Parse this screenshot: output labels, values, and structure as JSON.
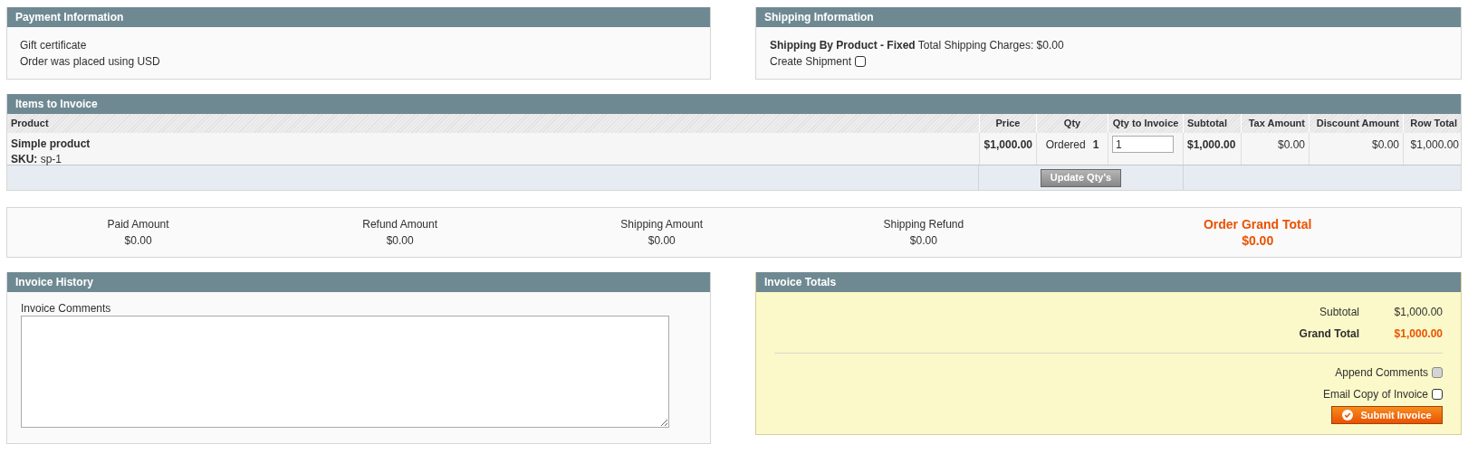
{
  "payment": {
    "title": "Payment Information",
    "lines": [
      "Gift certificate",
      "Order was placed using USD"
    ]
  },
  "shipping": {
    "title": "Shipping Information",
    "method": "Shipping By Product - Fixed",
    "charges": "Total Shipping Charges: $0.00",
    "create_shipment": {
      "label": "Create Shipment",
      "checked": false
    }
  },
  "items": {
    "title": "Items to Invoice",
    "columns": [
      "Product",
      "Price",
      "Qty",
      "Qty to Invoice",
      "Subtotal",
      "Tax Amount",
      "Discount Amount",
      "Row Total"
    ],
    "rows": [
      {
        "name": "Simple product",
        "sku_label": "SKU:",
        "sku": "sp-1",
        "price": "$1,000.00",
        "qty_label": "Ordered",
        "qty": "1",
        "qty_to_invoice": "1",
        "subtotal": "$1,000.00",
        "tax": "$0.00",
        "discount": "$0.00",
        "row_total": "$1,000.00"
      }
    ],
    "update_button": "Update Qty's"
  },
  "summary": [
    {
      "label": "Paid Amount",
      "value": "$0.00",
      "kind": "plain"
    },
    {
      "label": "Refund Amount",
      "value": "$0.00",
      "kind": "plain"
    },
    {
      "label": "Shipping Amount",
      "value": "$0.00",
      "kind": "plain"
    },
    {
      "label": "Shipping Refund",
      "value": "$0.00",
      "kind": "plain"
    },
    {
      "label": "Order Grand Total",
      "value": "$0.00",
      "kind": "grand"
    }
  ],
  "history": {
    "title": "Invoice History",
    "comments_label": "Invoice Comments"
  },
  "totals": {
    "title": "Invoice Totals",
    "rows": [
      {
        "label": "Subtotal",
        "value": "$1,000.00",
        "kind": "plain"
      },
      {
        "label": "Grand Total",
        "value": "$1,000.00",
        "kind": "grand"
      }
    ],
    "options": [
      {
        "label": "Append Comments",
        "checked": false,
        "disabled": true
      },
      {
        "label": "Email Copy of Invoice",
        "checked": false,
        "disabled": false
      }
    ],
    "submit_button": "Submit Invoice"
  }
}
